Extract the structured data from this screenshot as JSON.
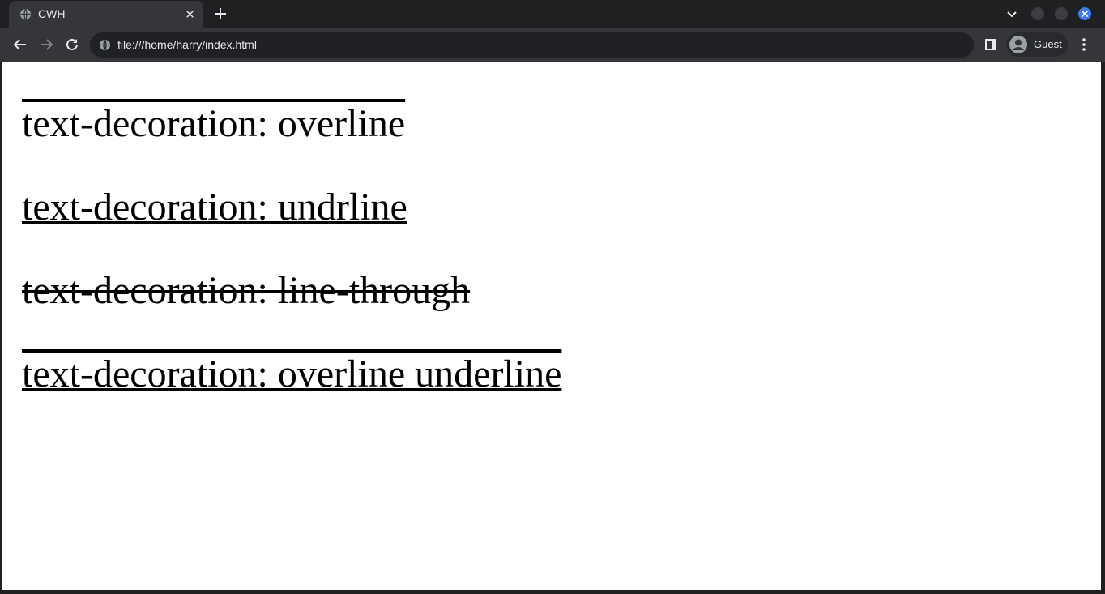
{
  "browser": {
    "tab": {
      "title": "CWH",
      "favicon": "globe-icon"
    },
    "toolbar": {
      "url": "file:///home/harry/index.html",
      "profile_name": "Guest"
    },
    "colors": {
      "frame": "#1f2022",
      "toolbar": "#35363a",
      "omnibox": "#202124",
      "close_accent": "#3d7cf0",
      "text": "#e8eaed"
    }
  },
  "page": {
    "lines": [
      {
        "text": "text-decoration: overline",
        "decoration": "overline"
      },
      {
        "text": "text-decoration: undrline",
        "decoration": "underline"
      },
      {
        "text": "text-decoration: line-through",
        "decoration": "line-through"
      },
      {
        "text": "text-decoration: overline underline",
        "decoration": "overline underline"
      }
    ]
  }
}
